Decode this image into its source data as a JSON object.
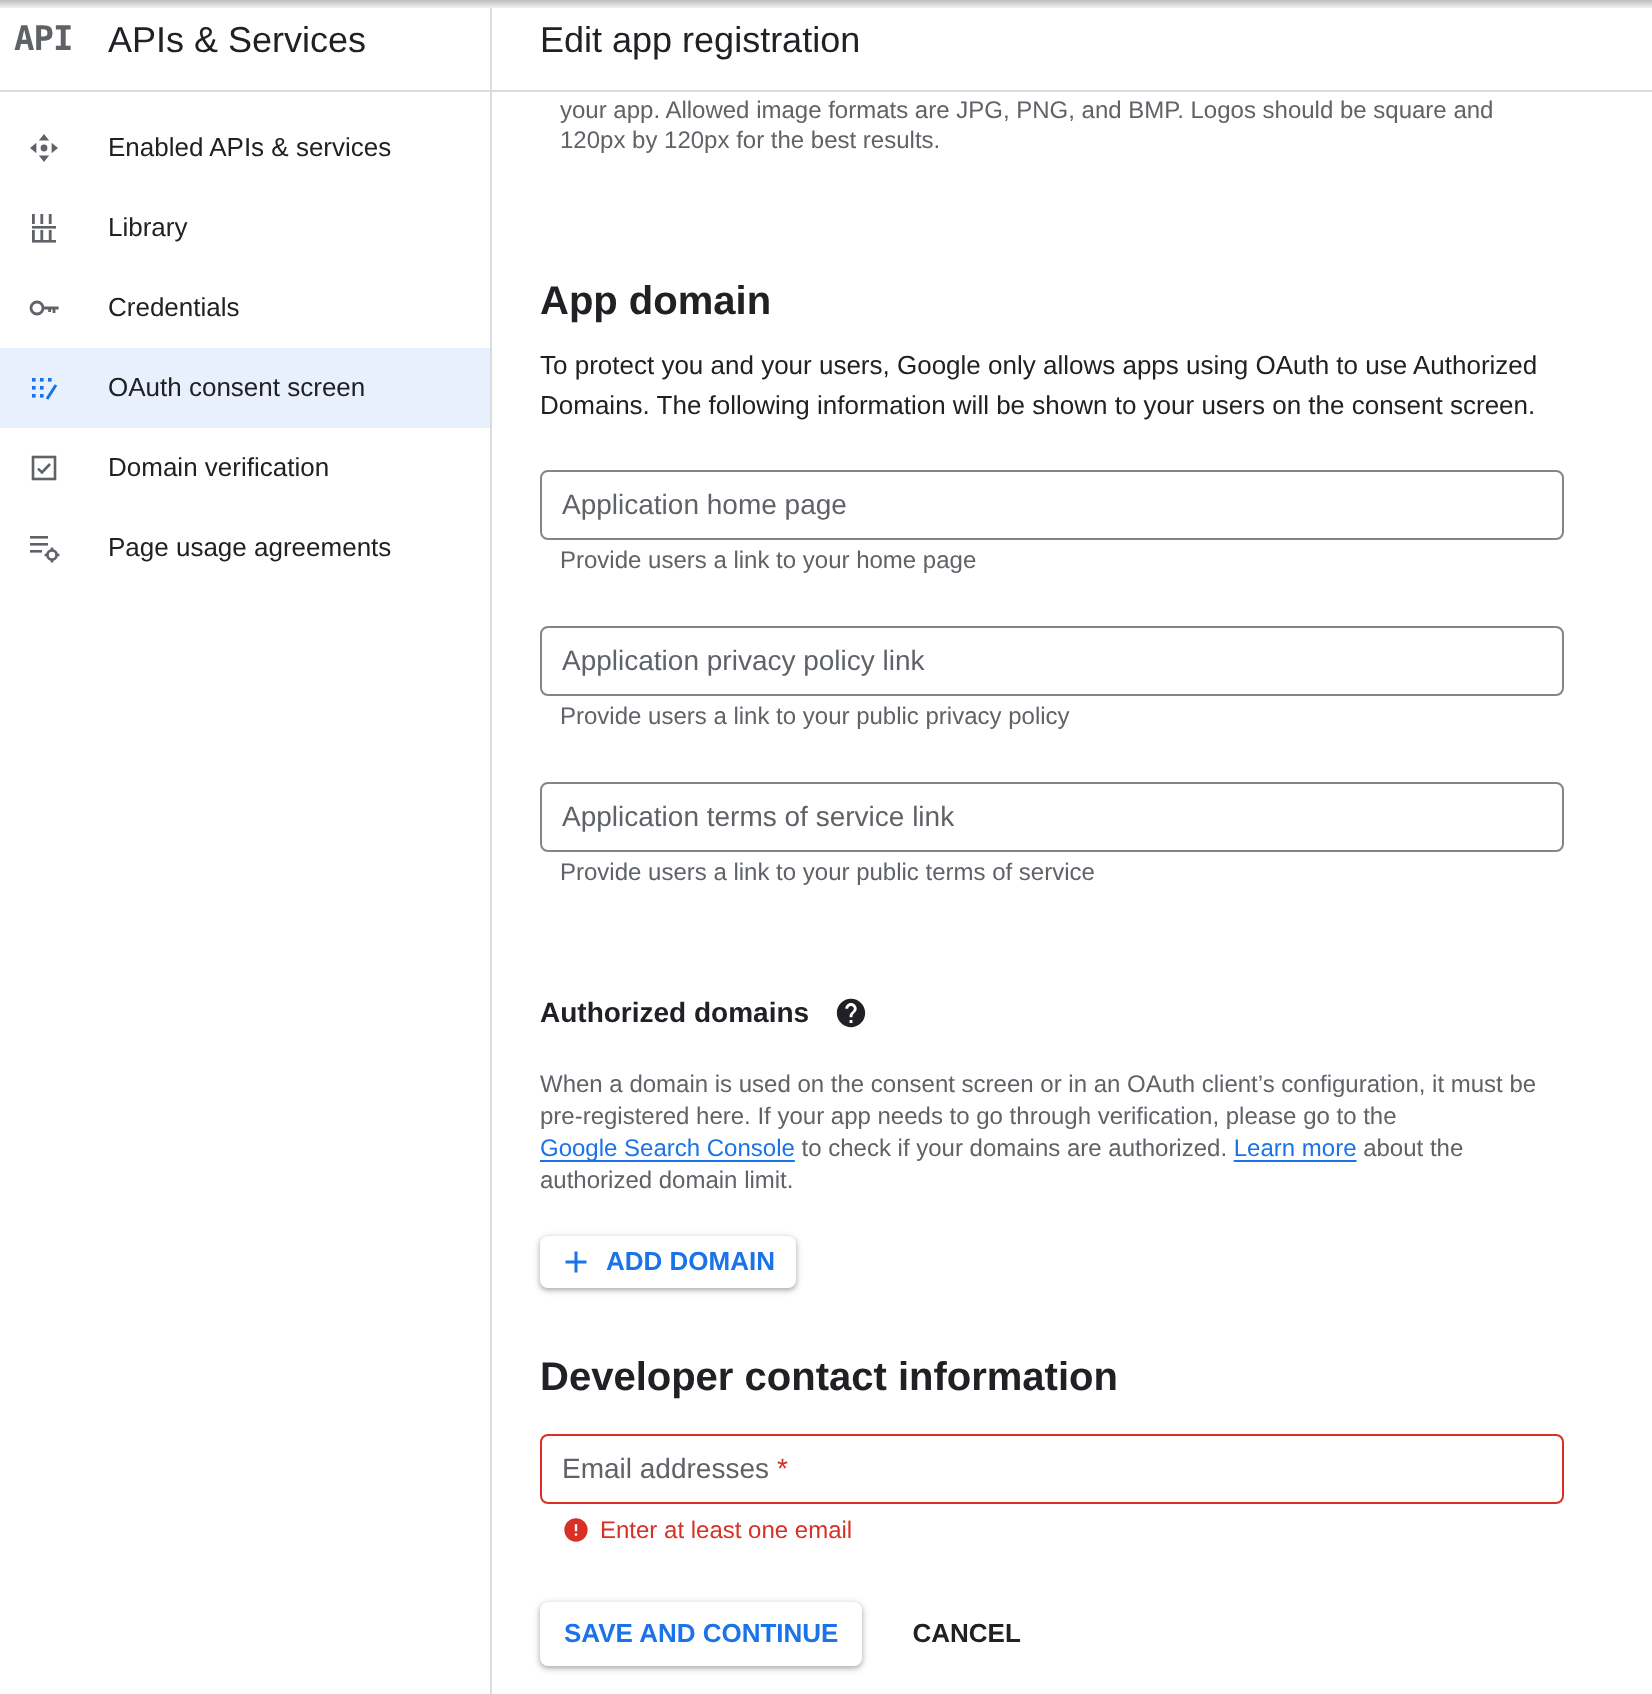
{
  "sidebar": {
    "logo": "API",
    "title": "APIs & Services",
    "items": [
      {
        "label": "Enabled APIs & services",
        "selected": false
      },
      {
        "label": "Library",
        "selected": false
      },
      {
        "label": "Credentials",
        "selected": false
      },
      {
        "label": "OAuth consent screen",
        "selected": true
      },
      {
        "label": "Domain verification",
        "selected": false
      },
      {
        "label": "Page usage agreements",
        "selected": false
      }
    ]
  },
  "header": {
    "title": "Edit app registration"
  },
  "logo_note": "your app. Allowed image formats are JPG, PNG, and BMP. Logos should be square and 120px by 120px for the best results.",
  "app_domain": {
    "heading": "App domain",
    "description": "To protect you and your users, Google only allows apps using OAuth to use Authorized Domains. The following information will be shown to your users on the consent screen.",
    "fields": [
      {
        "label": "Application home page",
        "helper": "Provide users a link to your home page",
        "error": false
      },
      {
        "label": "Application privacy policy link",
        "helper": "Provide users a link to your public privacy policy",
        "error": false
      },
      {
        "label": "Application terms of service link",
        "helper": "Provide users a link to your public terms of service",
        "error": false
      }
    ]
  },
  "authorized_domains": {
    "heading": "Authorized domains",
    "description": [
      {
        "text": "When a domain is used on the consent screen or in an OAuth client’s configuration, it must be pre-registered here. If your app needs to go through verification, please go to the ",
        "link": false
      },
      {
        "text": "Google Search Console",
        "link": true
      },
      {
        "text": " to check if your domains are authorized. ",
        "link": false
      },
      {
        "text": "Learn more",
        "link": true
      },
      {
        "text": " about the authorized domain limit.",
        "link": false
      }
    ],
    "add_button": "ADD DOMAIN"
  },
  "developer_contact": {
    "heading": "Developer contact information",
    "fields": [
      {
        "label": "Email addresses",
        "required_mark": "*",
        "error": true,
        "error_text": "Enter at least one email"
      }
    ]
  },
  "actions": [
    {
      "label": "SAVE AND CONTINUE",
      "kind": "raised"
    },
    {
      "label": "CANCEL",
      "kind": "text"
    }
  ]
}
